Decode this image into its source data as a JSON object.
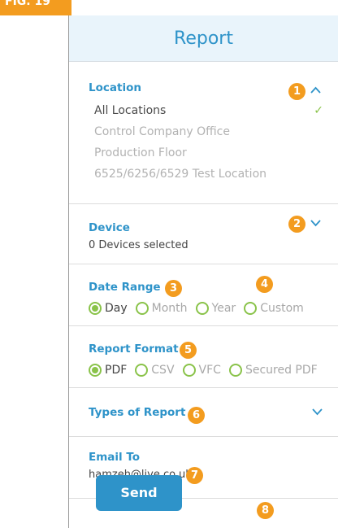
{
  "figure_label": "FIG. 19",
  "header": {
    "title": "Report"
  },
  "callouts": [
    "1",
    "2",
    "3",
    "4",
    "5",
    "6",
    "7",
    "8"
  ],
  "location": {
    "title": "Location",
    "items": [
      {
        "label": "All Locations",
        "selected": true
      },
      {
        "label": "Control Company Office",
        "selected": false
      },
      {
        "label": "Production Floor",
        "selected": false
      },
      {
        "label": "6525/6256/6529 Test Location",
        "selected": false
      }
    ]
  },
  "device": {
    "title": "Device",
    "subtitle": "0 Devices selected"
  },
  "date_range": {
    "title": "Date Range",
    "options": [
      "Day",
      "Month",
      "Year",
      "Custom"
    ],
    "selected": "Day"
  },
  "report_format": {
    "title": "Report Format",
    "options": [
      "PDF",
      "CSV",
      "VFC",
      "Secured PDF"
    ],
    "selected": "PDF"
  },
  "types_of_report": {
    "title": "Types of Report"
  },
  "email": {
    "title": "Email To",
    "value": "hamzeh@live.co.uk"
  },
  "send": {
    "label": "Send"
  },
  "colors": {
    "accent": "#2e93c9",
    "callout": "#f39c1f",
    "check": "#8ac34a",
    "header_bg": "#e9f4fb"
  },
  "icons": {
    "expanded": "chevron-up-icon",
    "collapsed": "chevron-down-icon",
    "selected": "check-icon"
  }
}
